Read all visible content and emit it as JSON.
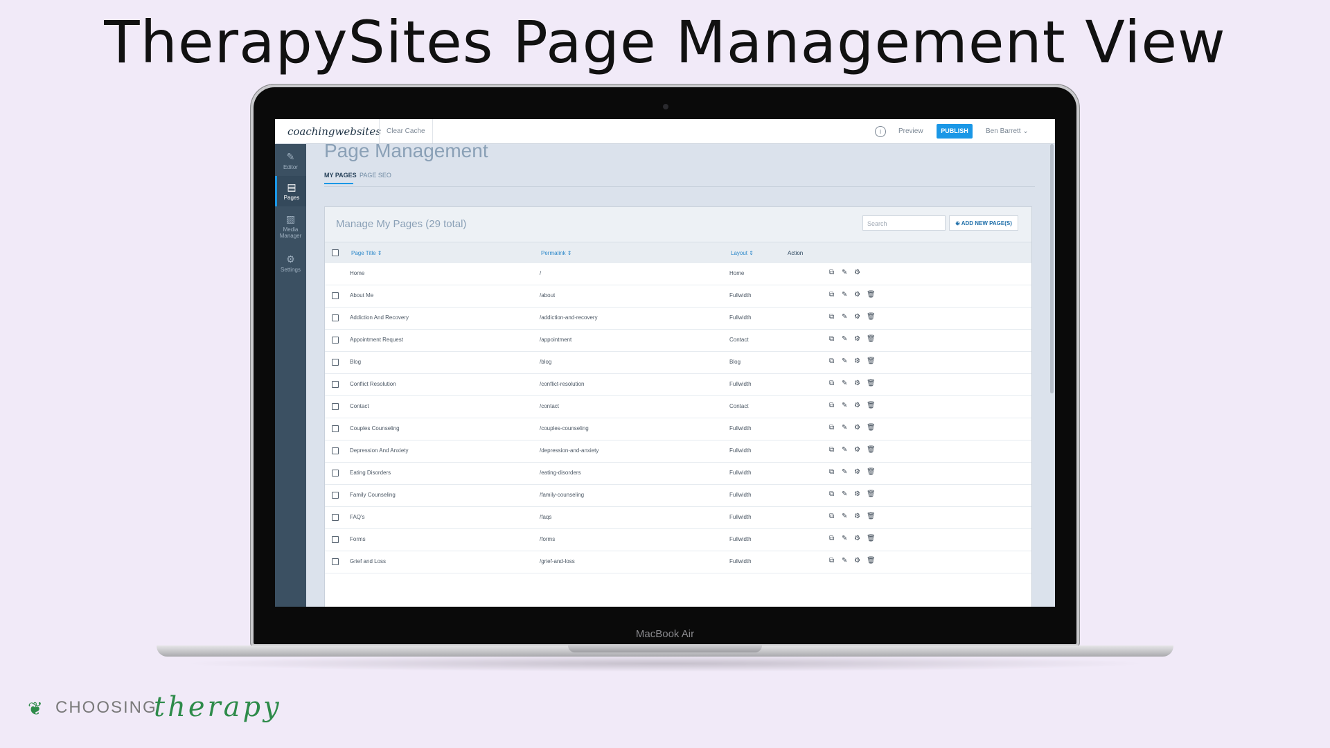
{
  "headline": "TherapySites Page Management View",
  "laptop_label": "MacBook Air",
  "app": {
    "logo": "coachingwebsites",
    "clear_cache": "Clear Cache",
    "info_icon": "i",
    "preview": "Preview",
    "publish": "PUBLISH",
    "user": "Ben Barrett ⌄"
  },
  "sidebar": {
    "items": [
      {
        "label": "Editor",
        "icon": "✎"
      },
      {
        "label": "Pages",
        "icon": "▤"
      },
      {
        "label": "Media Manager",
        "icon": "▨"
      },
      {
        "label": "Settings",
        "icon": "⚙"
      }
    ]
  },
  "main": {
    "title": "Page Management",
    "tabs": [
      "MY PAGES",
      "PAGE SEO"
    ]
  },
  "panel": {
    "title": "Manage My Pages (29 total)",
    "search_placeholder": "Search",
    "add_button": "⊕ ADD NEW PAGE(S)",
    "columns": [
      "Page Title ⇕",
      "Permalink ⇕",
      "Layout ⇕",
      "Action"
    ],
    "rows": [
      {
        "title": "Home",
        "permalink": "/",
        "layout": "Home"
      },
      {
        "title": "About Me",
        "permalink": "/about",
        "layout": "Fullwidth"
      },
      {
        "title": "Addiction And Recovery",
        "permalink": "/addiction-and-recovery",
        "layout": "Fullwidth"
      },
      {
        "title": "Appointment Request",
        "permalink": "/appointment",
        "layout": "Contact"
      },
      {
        "title": "Blog",
        "permalink": "/blog",
        "layout": "Blog"
      },
      {
        "title": "Conflict Resolution",
        "permalink": "/conflict-resolution",
        "layout": "Fullwidth"
      },
      {
        "title": "Contact",
        "permalink": "/contact",
        "layout": "Contact"
      },
      {
        "title": "Couples Counseling",
        "permalink": "/couples-counseling",
        "layout": "Fullwidth"
      },
      {
        "title": "Depression And Anxiety",
        "permalink": "/depression-and-anxiety",
        "layout": "Fullwidth"
      },
      {
        "title": "Eating Disorders",
        "permalink": "/eating-disorders",
        "layout": "Fullwidth"
      },
      {
        "title": "Family Counseling",
        "permalink": "/family-counseling",
        "layout": "Fullwidth"
      },
      {
        "title": "FAQ's",
        "permalink": "/faqs",
        "layout": "Fullwidth"
      },
      {
        "title": "Forms",
        "permalink": "/forms",
        "layout": "Fullwidth"
      },
      {
        "title": "Grief and Loss",
        "permalink": "/grief-and-loss",
        "layout": "Fullwidth"
      }
    ],
    "action_icons": {
      "copy": "⧉",
      "edit": "✎",
      "settings": "⚙",
      "delete": "🗑"
    }
  },
  "brand": {
    "leaf_icon": "❦",
    "word": "CHOOSING",
    "script": "therapy"
  },
  "colors": {
    "background": "#f1eaf8",
    "accent": "#1a97e6",
    "sidebar": "#3b5062",
    "brand_green": "#2e8b4a"
  }
}
